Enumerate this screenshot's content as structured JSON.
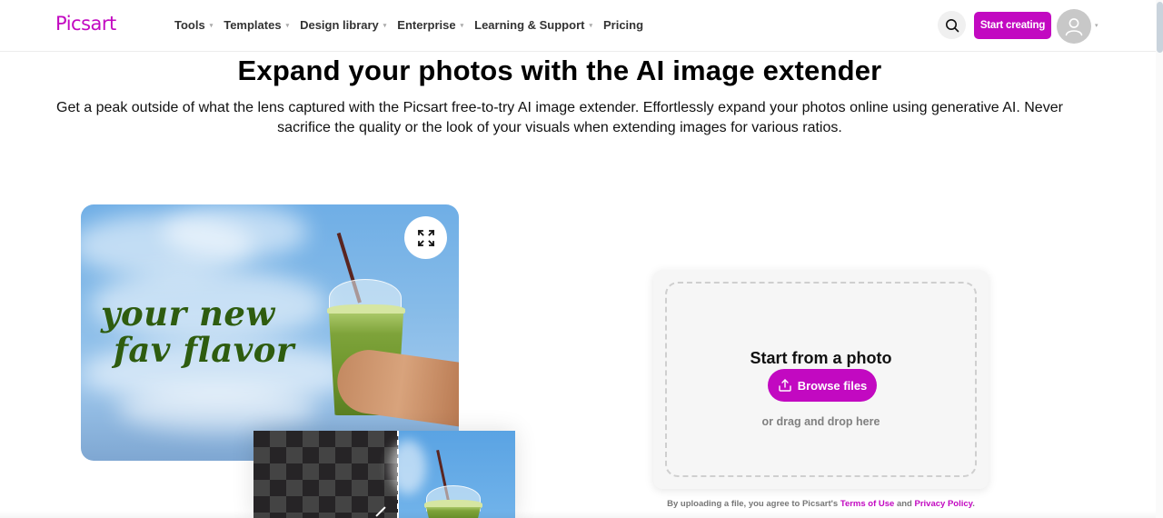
{
  "header": {
    "logo": "Picsart",
    "nav": [
      {
        "label": "Tools",
        "has_dropdown": true
      },
      {
        "label": "Templates",
        "has_dropdown": true
      },
      {
        "label": "Design library",
        "has_dropdown": true
      },
      {
        "label": "Enterprise",
        "has_dropdown": true
      },
      {
        "label": "Learning & Support",
        "has_dropdown": true
      },
      {
        "label": "Pricing",
        "has_dropdown": false
      }
    ],
    "search_icon": "search-icon",
    "cta_label": "Start creating",
    "avatar_icon": "user-icon",
    "caret": "▾"
  },
  "hero": {
    "title": "Expand your photos with the AI image extender",
    "subtitle": "Get a peak outside of what the lens captured with the Picsart free-to-try AI image extender. Effortlessly expand your photos online using generative AI. Never sacrifice the quality or the look of your visuals when extending images for various ratios.",
    "image_text_line1": "your new",
    "image_text_line2": "fav flavor",
    "expand_icon": "expand-icon"
  },
  "upload": {
    "title": "Start from a photo",
    "browse_label": "Browse files",
    "upload_icon": "upload-icon",
    "drag_text": "or drag and drop here",
    "legal_prefix": "By uploading a file, you agree to Picsart's ",
    "terms_label": "Terms of Use",
    "legal_and": " and ",
    "privacy_label": "Privacy Policy",
    "legal_suffix": "."
  },
  "colors": {
    "brand": "#c209c1",
    "hero_text": "#2e5c0f"
  }
}
